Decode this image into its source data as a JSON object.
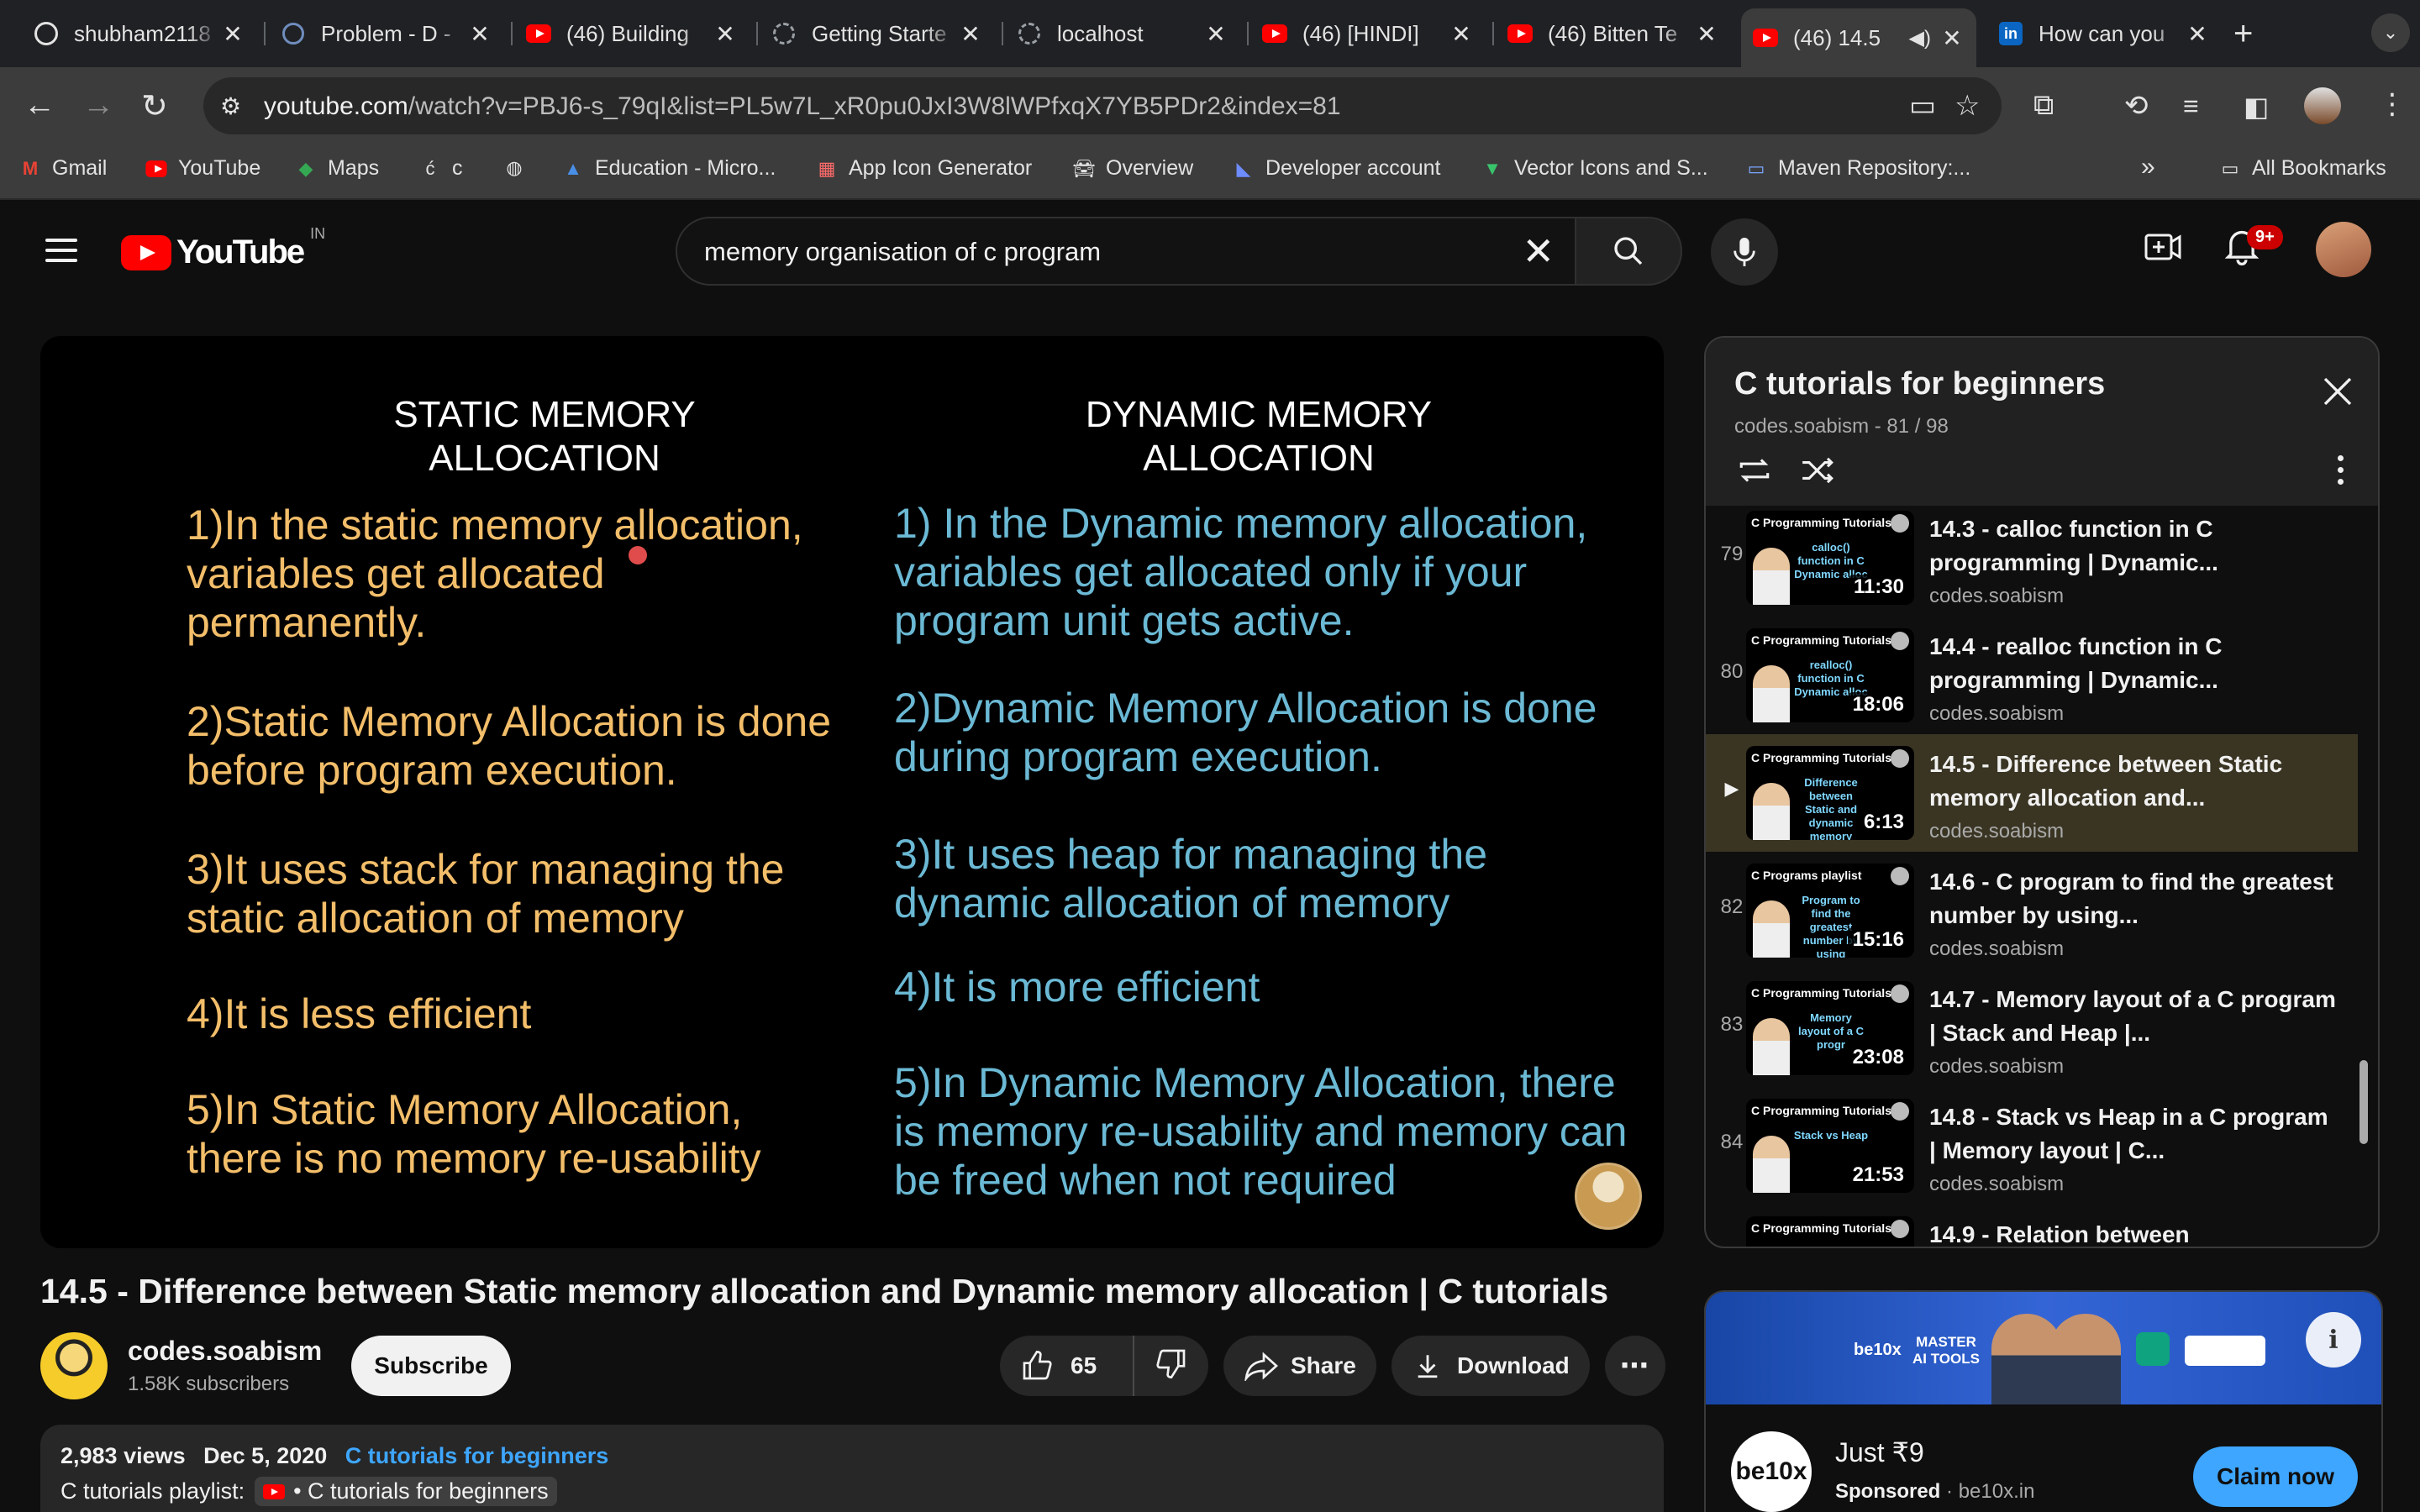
{
  "browser": {
    "tabs": [
      {
        "title": "shubham2118",
        "icon": "github-icon"
      },
      {
        "title": "Problem - D - ",
        "icon": "codeforces-icon"
      },
      {
        "title": "(46) Building ",
        "icon": "youtube-icon"
      },
      {
        "title": "Getting Starte",
        "icon": "loading-icon"
      },
      {
        "title": "localhost",
        "icon": "loading-icon"
      },
      {
        "title": "(46) [HINDI] ",
        "icon": "youtube-icon"
      },
      {
        "title": "(46) Bitten Te",
        "icon": "youtube-icon"
      },
      {
        "title": "(46) 14.5",
        "icon": "youtube-icon",
        "active": true
      },
      {
        "title": "How can you",
        "icon": "linkedin-icon"
      }
    ],
    "url_host": "youtube.com",
    "url_path": "/watch?v=PBJ6-s_79qI&list=PL5w7L_xR0pu0JxI3W8lWPfxqX7YB5PDr2&index=81",
    "bookmarks": [
      {
        "label": "Gmail",
        "icon": "gmail-icon"
      },
      {
        "label": "YouTube",
        "icon": "youtube-icon"
      },
      {
        "label": "Maps",
        "icon": "maps-icon"
      },
      {
        "label": "c",
        "icon": "c-icon"
      },
      {
        "label": "",
        "icon": "globe-icon"
      },
      {
        "label": "Education - Micro...",
        "icon": "microsoft-icon"
      },
      {
        "label": "App Icon Generator",
        "icon": "grid-icon"
      },
      {
        "label": "Overview",
        "icon": "car-icon"
      },
      {
        "label": "Developer account",
        "icon": "dev-icon"
      },
      {
        "label": "Vector Icons and S...",
        "icon": "vector-icon"
      },
      {
        "label": "Maven Repository:...",
        "icon": "maven-icon"
      }
    ],
    "all_bookmarks": "All Bookmarks"
  },
  "youtube": {
    "logo_text": "YouTube",
    "country_code": "IN",
    "search_query": "memory organisation of c program",
    "notification_count": "9+"
  },
  "player": {
    "static_title_1": "STATIC MEMORY",
    "static_title_2": "ALLOCATION",
    "dynamic_title_1": "DYNAMIC MEMORY",
    "dynamic_title_2": "ALLOCATION",
    "static_points": [
      [
        "1)In the static memory allocation,",
        "variables get allocated",
        "permanently."
      ],
      [
        "2)Static Memory Allocation is done",
        "before program execution."
      ],
      [
        "3)It uses stack for managing the",
        "static allocation of memory"
      ],
      [
        "4)It is less efficient"
      ],
      [
        "5)In Static Memory Allocation,",
        "there is no memory re-usability"
      ]
    ],
    "dynamic_points": [
      [
        "1) In the Dynamic memory allocation,",
        "variables get allocated only if your",
        "program unit gets active."
      ],
      [
        "2)Dynamic Memory Allocation is done",
        "during program execution."
      ],
      [
        "3)It uses heap for managing the",
        "dynamic allocation of memory"
      ],
      [
        "4)It is more efficient"
      ],
      [
        "5)In Dynamic Memory Allocation, there",
        "is memory re-usability and memory can",
        "be freed when not required"
      ]
    ]
  },
  "video": {
    "title": "14.5 - Difference between Static memory allocation and Dynamic memory allocation | C tutorials",
    "channel": "codes.soabism",
    "subscribers": "1.58K subscribers",
    "subscribe_label": "Subscribe",
    "likes": "65",
    "share_label": "Share",
    "download_label": "Download",
    "views": "2,983 views",
    "date": "Dec 5, 2020",
    "playlist_link": "C tutorials for beginners",
    "playlist_prefix": "C tutorials playlist:",
    "playlist_chip": "• C tutorials for beginners"
  },
  "playlist": {
    "title": "C tutorials for beginners",
    "channel": "codes.soabism",
    "position": "81 / 98",
    "items": [
      {
        "index": "79",
        "title": "14.3 - calloc function in C programming | Dynamic...",
        "channel": "codes.soabism",
        "duration": "11:30",
        "thumb_head": "C Programming Tutorials",
        "thumb_body": "calloc() function in C Dynamic alloc"
      },
      {
        "index": "80",
        "title": "14.4 - realloc function in C programming | Dynamic...",
        "channel": "codes.soabism",
        "duration": "18:06",
        "thumb_head": "C Programming Tutorials",
        "thumb_body": "realloc() function in C Dynamic alloc"
      },
      {
        "index": "",
        "title": "14.5 - Difference between Static memory allocation and...",
        "channel": "codes.soabism",
        "duration": "6:13",
        "thumb_head": "C Programming Tutorials",
        "thumb_body": "Difference between Static and dynamic memory",
        "current": true
      },
      {
        "index": "82",
        "title": "14.6 - C program to find the greatest number by using...",
        "channel": "codes.soabism",
        "duration": "15:16",
        "thumb_head": "C Programs playlist",
        "thumb_body": "Program to find the greatest number by using"
      },
      {
        "index": "83",
        "title": "14.7 - Memory layout of a C program | Stack and Heap |...",
        "channel": "codes.soabism",
        "duration": "23:08",
        "thumb_head": "C Programming Tutorials",
        "thumb_body": "Memory layout of a C progr"
      },
      {
        "index": "84",
        "title": "14.8 - Stack vs Heap in a C program | Memory layout | C...",
        "channel": "codes.soabism",
        "duration": "21:53",
        "thumb_head": "C Programming Tutorials",
        "thumb_body": "Stack vs Heap"
      },
      {
        "index": "",
        "title": "14.9 - Relation between",
        "channel": "",
        "duration": "",
        "thumb_head": "C Programming Tutorials",
        "thumb_body": ""
      }
    ]
  },
  "ad": {
    "brand": "be10x",
    "headline_1": "MASTER",
    "headline_2": "AI TOOLS",
    "price": "Just ₹9",
    "sponsored": "Sponsored",
    "domain": "be10x.in",
    "cta": "Claim now"
  }
}
